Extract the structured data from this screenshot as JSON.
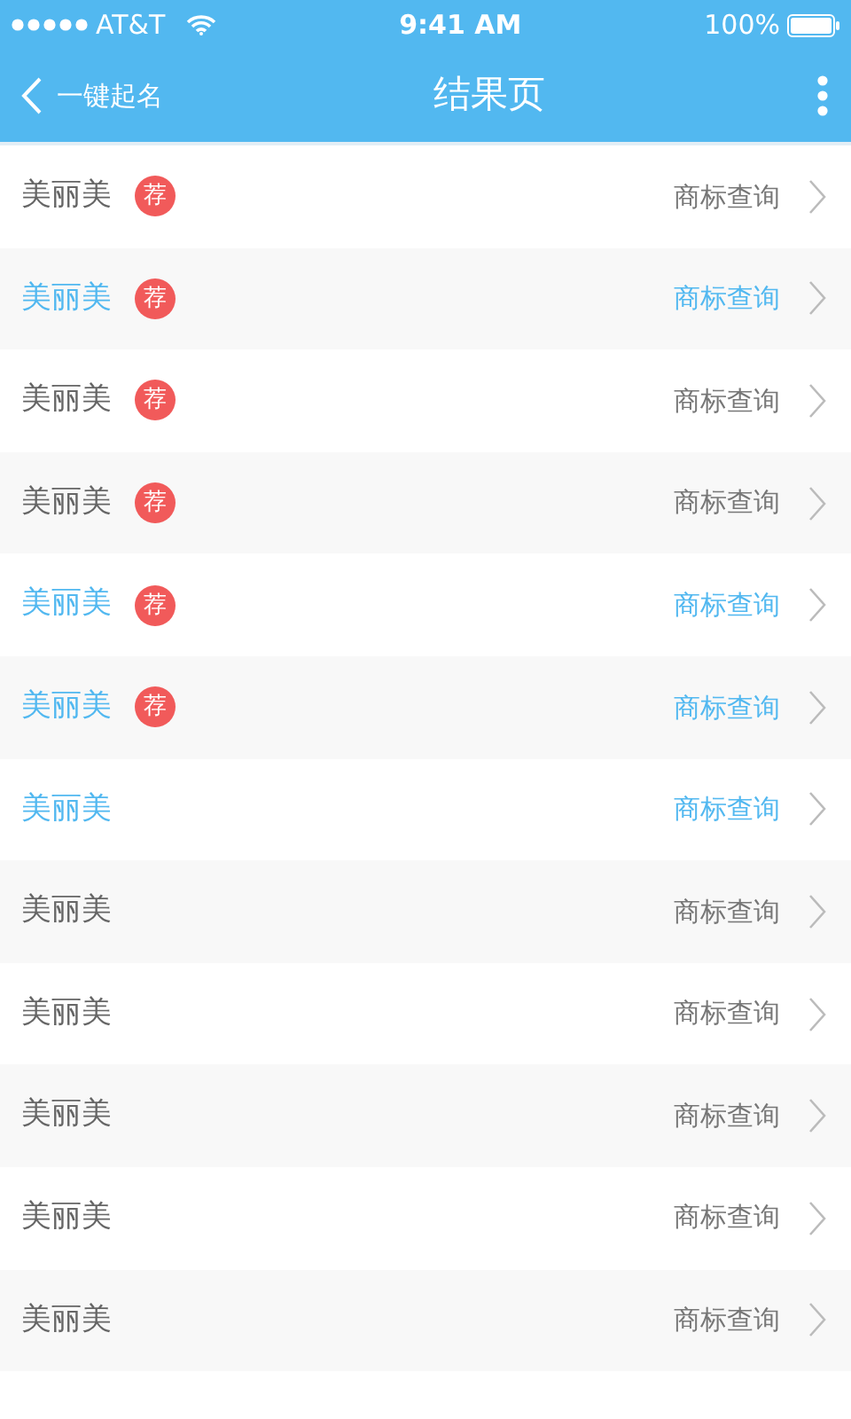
{
  "status_bar": {
    "carrier": "AT&T",
    "time": "9:41 AM",
    "battery": "100%"
  },
  "nav": {
    "back_label": "一键起名",
    "title": "结果页"
  },
  "rows": [
    {
      "name": "美丽美",
      "badge": "荐",
      "action": "商标查询",
      "highlighted": false
    },
    {
      "name": "美丽美",
      "badge": "荐",
      "action": "商标查询",
      "highlighted": true
    },
    {
      "name": "美丽美",
      "badge": "荐",
      "action": "商标查询",
      "highlighted": false
    },
    {
      "name": "美丽美",
      "badge": "荐",
      "action": "商标查询",
      "highlighted": false
    },
    {
      "name": "美丽美",
      "badge": "荐",
      "action": "商标查询",
      "highlighted": true
    },
    {
      "name": "美丽美",
      "badge": "荐",
      "action": "商标查询",
      "highlighted": true
    },
    {
      "name": "美丽美",
      "action": "商标查询",
      "highlighted": true
    },
    {
      "name": "美丽美",
      "action": "商标查询",
      "highlighted": false
    },
    {
      "name": "美丽美",
      "action": "商标查询",
      "highlighted": false
    },
    {
      "name": "美丽美",
      "action": "商标查询",
      "highlighted": false
    },
    {
      "name": "美丽美",
      "action": "商标查询",
      "highlighted": false
    },
    {
      "name": "美丽美",
      "action": "商标查询",
      "highlighted": false
    }
  ]
}
